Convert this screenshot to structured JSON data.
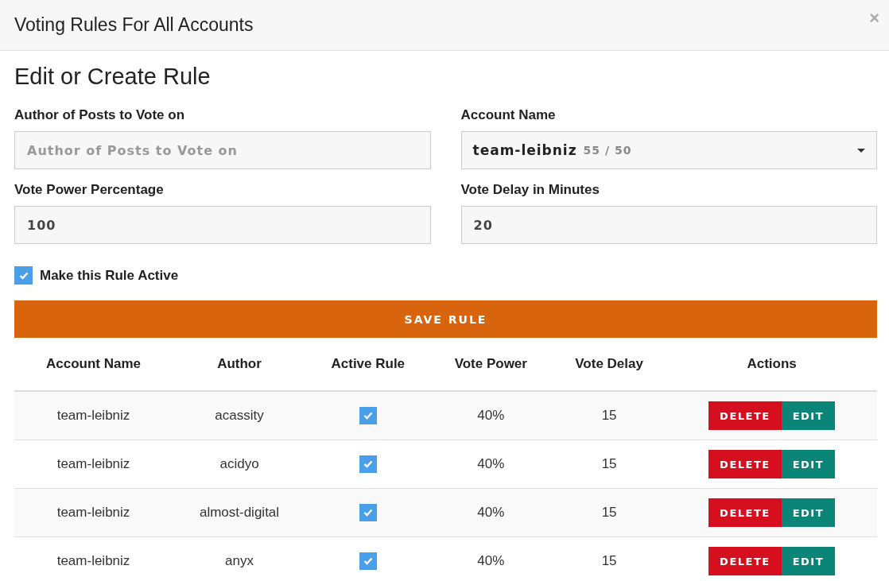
{
  "window": {
    "title": "Voting Rules For All Accounts",
    "close": "×"
  },
  "form": {
    "heading": "Edit or Create Rule",
    "fields": [
      {
        "kind": "text",
        "label": "Author of Posts to Vote on",
        "placeholder": "Author of Posts to Vote on"
      },
      {
        "kind": "select",
        "label": "Account Name",
        "value": "team-leibniz",
        "note": "55 / 50"
      },
      {
        "kind": "text",
        "label": "Vote Power Percentage",
        "value": "100"
      },
      {
        "kind": "text",
        "label": "Vote Delay in Minutes",
        "value": "20"
      }
    ],
    "active": {
      "label": "Make this Rule Active",
      "checked": true
    },
    "save_button": "SAVE RULE"
  },
  "table": {
    "columns": [
      "Account Name",
      "Author",
      "Active Rule",
      "Vote Power",
      "Vote Delay",
      "Actions"
    ],
    "rows": [
      {
        "account": "team-leibniz",
        "author": "acassity",
        "active": true,
        "power": "40%",
        "delay": "15",
        "delete": "DELETE",
        "edit": "EDIT"
      },
      {
        "account": "team-leibniz",
        "author": "acidyo",
        "active": true,
        "power": "40%",
        "delay": "15",
        "delete": "DELETE",
        "edit": "EDIT"
      },
      {
        "account": "team-leibniz",
        "author": "almost-digital",
        "active": true,
        "power": "40%",
        "delay": "15",
        "delete": "DELETE",
        "edit": "EDIT"
      },
      {
        "account": "team-leibniz",
        "author": "anyx",
        "active": true,
        "power": "40%",
        "delay": "15",
        "delete": "DELETE",
        "edit": "EDIT"
      }
    ]
  }
}
